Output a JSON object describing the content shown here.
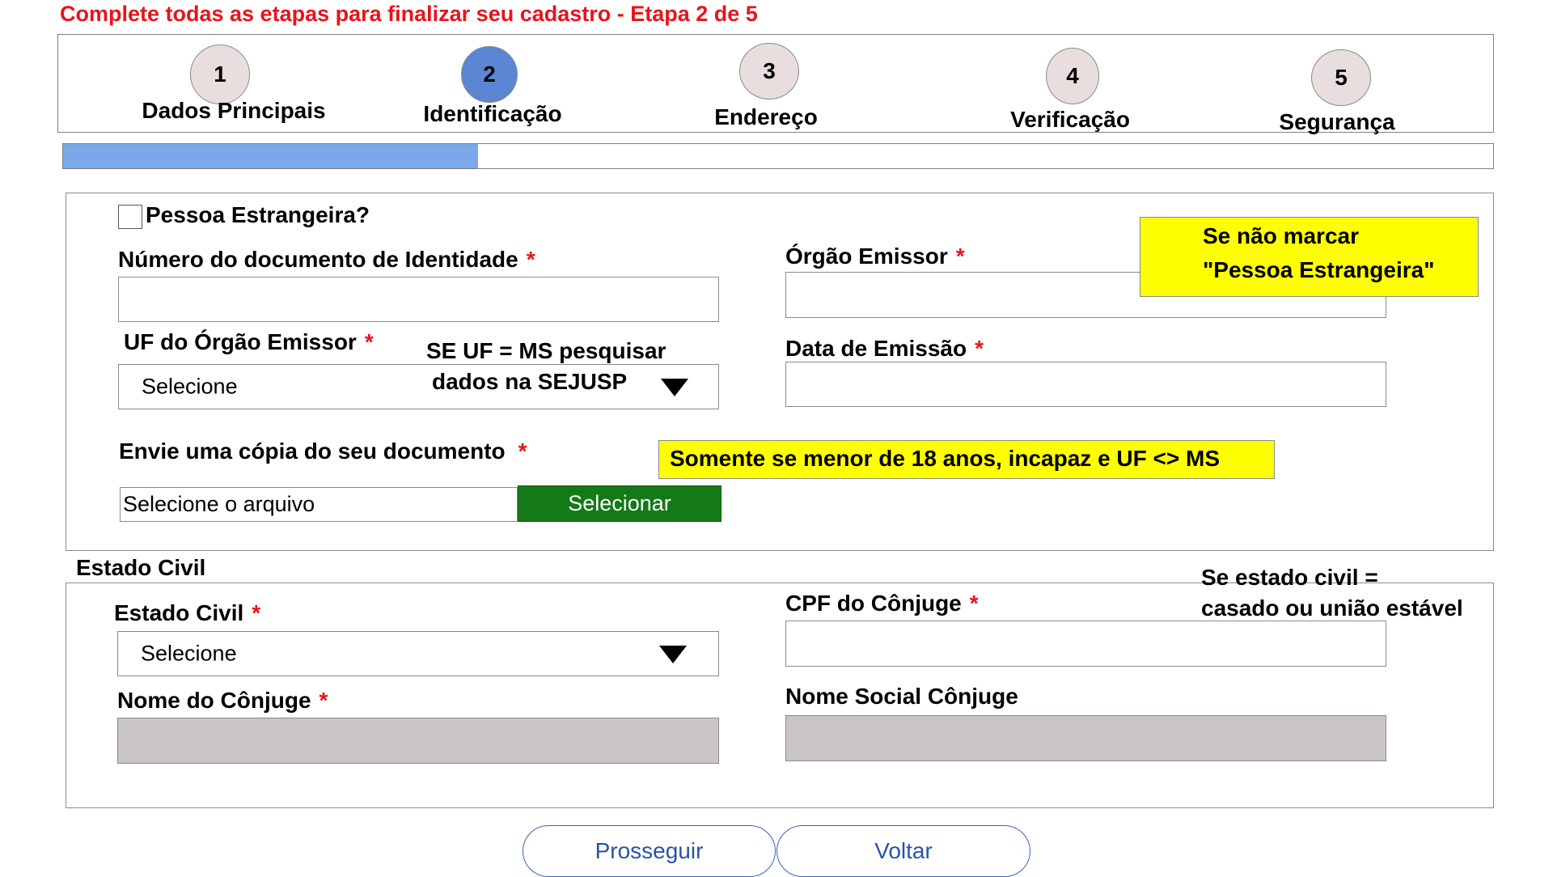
{
  "instruction": "Complete todas as etapas para finalizar seu cadastro - Etapa 2 de 5",
  "steps": [
    {
      "number": "1",
      "label": "Dados Principais"
    },
    {
      "number": "2",
      "label": "Identificação"
    },
    {
      "number": "3",
      "label": "Endereço"
    },
    {
      "number": "4",
      "label": "Verificação"
    },
    {
      "number": "5",
      "label": "Segurança"
    }
  ],
  "current_step": 2,
  "progress_fraction": 0.29,
  "colors": {
    "instruction": "#e8141b",
    "active_step": "#5b86d4",
    "progress": "#7aa8ea",
    "select_file_button": "#137a17",
    "note_highlight": "#ffff00",
    "disabled_field": "#c9c5c5"
  },
  "identification": {
    "foreigner_checkbox_label": "Pessoa Estrangeira?",
    "foreigner_checked": false,
    "id_number_label": "Número do documento de Identidade",
    "id_number_value": "",
    "issuer_label": "Órgão Emissor",
    "issuer_value": "",
    "issuer_uf_label": "UF do Órgão Emissor",
    "issuer_uf_value": "Selecione",
    "issue_date_label": "Data de Emissão",
    "issue_date_value": "",
    "upload_label": "Envie uma cópia do seu documento",
    "file_placeholder": "Selecione o arquivo",
    "file_button": "Selecionar",
    "required_mark": "*"
  },
  "annotations": {
    "foreigner_note_line1": "Se não marcar",
    "foreigner_note_line2": "\"Pessoa Estrangeira\"",
    "uf_note_line1": "SE UF = MS pesquisar",
    "uf_note_line2": "dados na SEJUSP",
    "upload_note": "Somente se menor de 18 anos, incapaz e UF <> MS",
    "spouse_note_line1": "Se estado civil =",
    "spouse_note_line2": "casado ou união estável"
  },
  "marital": {
    "section_title": "Estado Civil",
    "marital_status_label": "Estado Civil",
    "marital_status_value": "Selecione",
    "spouse_cpf_label": "CPF do Cônjuge",
    "spouse_cpf_value": "",
    "spouse_name_label": "Nome do Cônjuge",
    "spouse_name_value": "",
    "spouse_social_name_label": "Nome Social Cônjuge",
    "spouse_social_name_value": ""
  },
  "buttons": {
    "proceed": "Prosseguir",
    "back": "Voltar"
  }
}
